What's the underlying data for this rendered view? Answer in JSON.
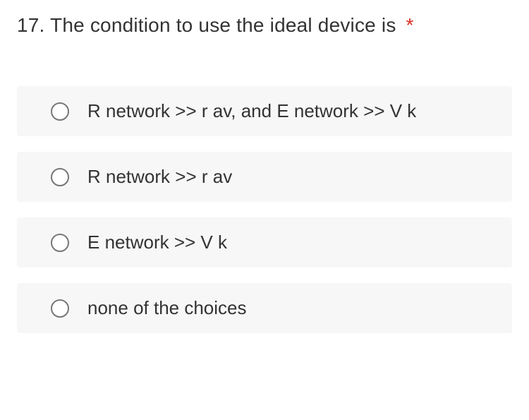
{
  "question": {
    "number": "17.",
    "text": "The condition to use the ideal device is",
    "required_mark": "*"
  },
  "options": [
    {
      "label": "R network >> r av, and E network >> V k"
    },
    {
      "label": "R network >> r av"
    },
    {
      "label": "E network >> V k"
    },
    {
      "label": "none of the choices"
    }
  ]
}
